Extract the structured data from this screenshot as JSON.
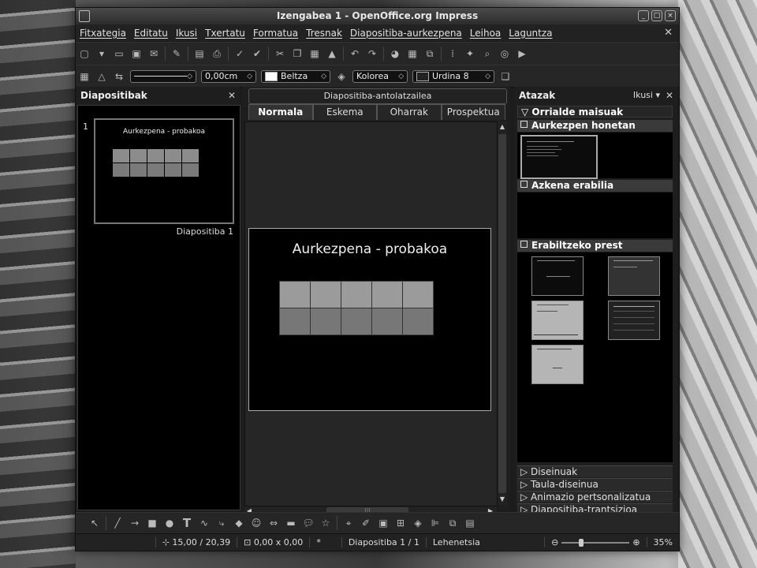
{
  "window": {
    "title": "Izengabea 1 - OpenOffice.org Impress"
  },
  "menu": [
    "Fitxategia",
    "Editatu",
    "Ikusi",
    "Txertatu",
    "Formatua",
    "Tresnak",
    "Diapositiba-aurkezpena",
    "Leihoa",
    "Laguntza"
  ],
  "line_props": {
    "width_value": "0,00cm",
    "line_color": "Beltza",
    "area_style": "Kolorea",
    "area_color": "Urdina 8"
  },
  "slides_pane": {
    "title": "Diapositibak",
    "thumb_number": "1",
    "thumb_title": "Aurkezpena - probakoa",
    "thumb_label": "Diapositiba 1"
  },
  "editor": {
    "design_title": "Diapositiba-antolatzailea",
    "tabs": [
      "Normala",
      "Eskema",
      "Oharrak",
      "Prospektua"
    ],
    "active_tab": "Normala",
    "slide_title": "Aurkezpena - probakoa"
  },
  "tasks": {
    "title": "Atazak",
    "view_label": "Ikusi",
    "section_master": "Orrialde maisuak",
    "used_here": "Aurkezpen honetan erabilia",
    "recent": "Azkena erabilia",
    "available": "Erabiltzeko prest",
    "bottom_sections": [
      "Diseinuak",
      "Taula-diseinua",
      "Animazio pertsonalizatua",
      "Diapositiba-trantsizioa"
    ]
  },
  "status": {
    "position": "15,00 / 20,39",
    "size": "0,00 x 0,00",
    "modified": "*",
    "slide": "Diapositiba 1 / 1",
    "layout": "Lehenetsia",
    "zoom": "35%"
  },
  "colors": {
    "window_bg": "#1c1c1c",
    "slide_bg": "#000000",
    "table_cell": "#9b9b9b"
  }
}
